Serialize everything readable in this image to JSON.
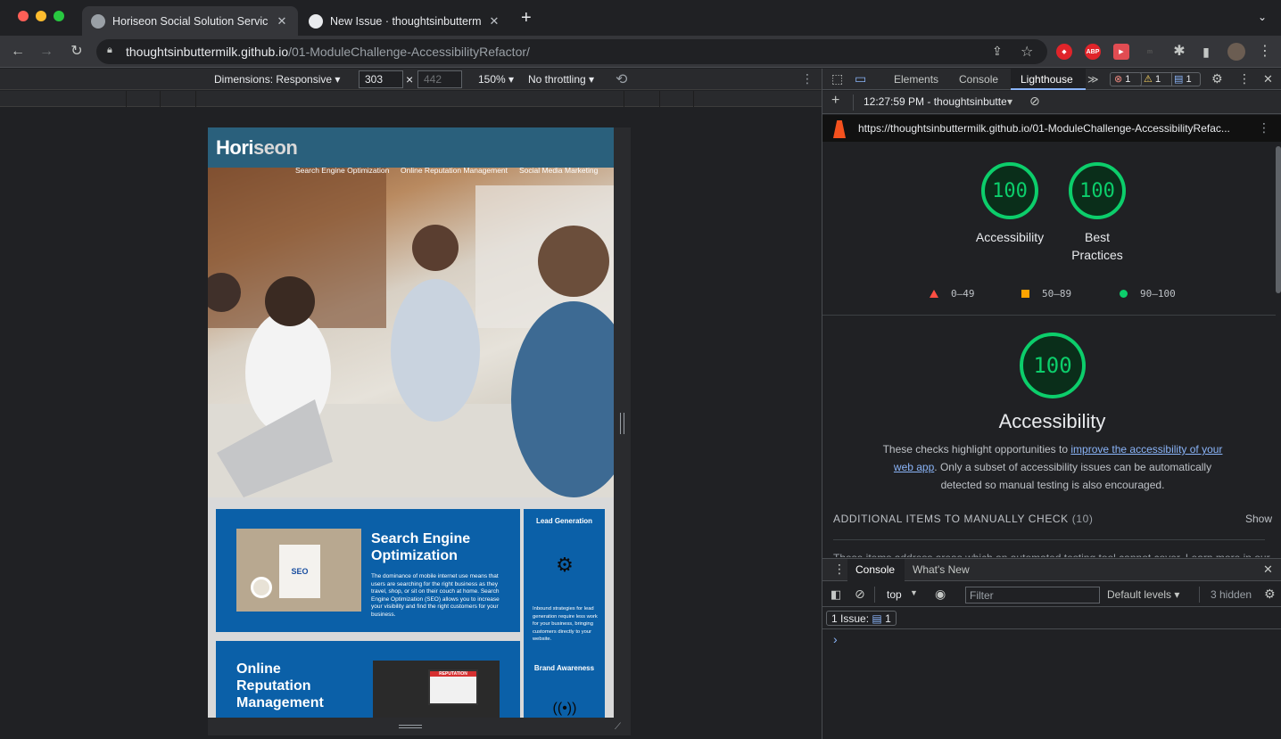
{
  "browser": {
    "tabs": [
      {
        "title": "Horiseon Social Solution Servic",
        "active": true
      },
      {
        "title": "New Issue · thoughtsinbutterm",
        "active": false
      }
    ],
    "new_tab": "+",
    "url_host": "thoughtsinbuttermilk.github.io",
    "url_path": "/01-ModuleChallenge-AccessibilityRefactor/",
    "extensions": [
      "ABP"
    ]
  },
  "device_toolbar": {
    "dimensions": "Dimensions: Responsive ▾",
    "width": "303",
    "height": "442",
    "times": "×",
    "zoom": "150% ▾",
    "throttling": "No throttling ▾"
  },
  "site": {
    "logo_main": "Hori",
    "logo_rest": "seon",
    "nav": [
      "Search Engine Optimization",
      "Online Reputation Management",
      "Social Media Marketing"
    ],
    "seo_title": "Search Engine Optimization",
    "seo_body": "The dominance of mobile internet use means that users are searching for the right business as they travel, shop, or sit on their couch at home. Search Engine Optimization (SEO) allows you to increase your visibility and find the right customers for your business.",
    "orm_title": "Online Reputation Management",
    "side_lead_title": "Lead Generation",
    "side_lead_body": "Inbound strategies for lead generation require less work for your business, bringing customers directly to your website.",
    "side_brand_title": "Brand Awareness",
    "seo_image_text": "SEO",
    "orm_image_text": "REPUTATION"
  },
  "devtools": {
    "tabs": [
      "Elements",
      "Console",
      "Lighthouse"
    ],
    "active_tab": "Lighthouse",
    "more_tabs": "≫",
    "errors": "1",
    "warnings": "1",
    "issues": "1",
    "report_time": "12:27:59 PM - thoughtsinbutte",
    "report_url": "https://thoughtsinbuttermilk.github.io/01-ModuleChallenge-AccessibilityRefac...",
    "scores": [
      {
        "value": "100",
        "label": "Accessibility"
      },
      {
        "value": "100",
        "label": "Best Practices"
      }
    ],
    "legend": [
      "0–49",
      "50–89",
      "90–100"
    ],
    "main_score": "100",
    "main_title": "Accessibility",
    "desc_pre": "These checks highlight opportunities to ",
    "desc_link": "improve the accessibility of your web app",
    "desc_post": ". Only a subset of accessibility issues can be automatically detected so manual testing is also encouraged.",
    "manual_title": "ADDITIONAL ITEMS TO MANUALLY CHECK",
    "manual_count": "(10)",
    "show": "Show",
    "manual_desc": "These items address areas which an automated testing tool cannot cover. Learn more in our"
  },
  "console": {
    "tabs": [
      "Console",
      "What's New"
    ],
    "context": "top",
    "filter_placeholder": "Filter",
    "levels": "Default levels ▾",
    "hidden": "3 hidden",
    "issue_label": "1 Issue:",
    "issue_count": "1",
    "prompt": "›"
  },
  "colors": {
    "pass": "#0cce6b",
    "average": "#ffa400",
    "fail": "#ff4e42",
    "site_header": "#2a607c",
    "site_box": "#0b60a8"
  }
}
